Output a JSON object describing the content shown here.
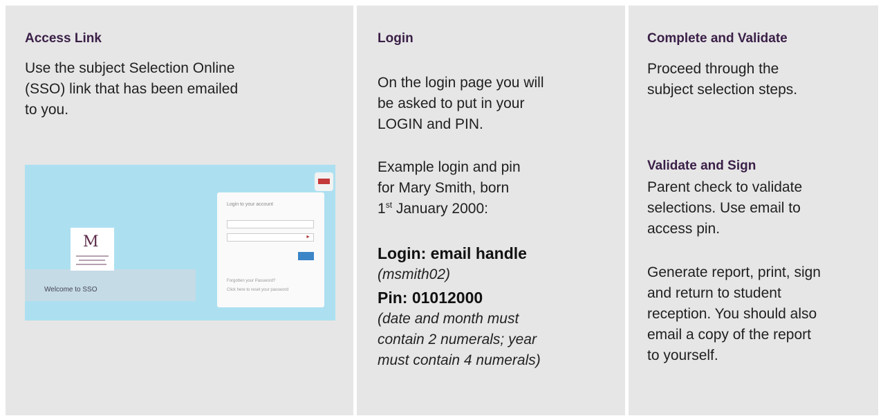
{
  "access_link": {
    "heading": "Access Link",
    "body_lines": [
      "Use the subject Selection Online",
      "(SSO) link that has been emailed",
      "to you."
    ],
    "screenshot": {
      "login_title": "Login to your account",
      "forgot": "Forgotten your Password?",
      "reset_hint": "Click here to reset your password",
      "welcome": "Welcome to SSO"
    }
  },
  "login": {
    "heading": "Login",
    "intro_lines": [
      "On the login page you will",
      "be asked to put in your",
      "LOGIN and PIN."
    ],
    "example_lines": [
      "Example login and pin",
      "for Mary Smith, born"
    ],
    "example_date_prefix": "1",
    "example_date_sup": "st",
    "example_date_rest": " January 2000:",
    "login_label": "Login: email handle",
    "login_example": "(msmith02)",
    "pin_label": "Pin: 01012000",
    "pin_note_lines": [
      "(date and month must",
      "contain 2 numerals; year",
      "must contain 4 numerals)"
    ]
  },
  "complete": {
    "heading": "Complete and Validate",
    "body_lines": [
      "Proceed through the",
      "subject selection steps."
    ],
    "sign_heading": "Validate and Sign",
    "sign_lines": [
      "Parent check to validate",
      "selections. Use email to",
      "access pin."
    ],
    "report_lines": [
      "Generate report, print, sign",
      "and return to student",
      "reception. You should also",
      "email a copy of the report",
      "to yourself."
    ]
  }
}
